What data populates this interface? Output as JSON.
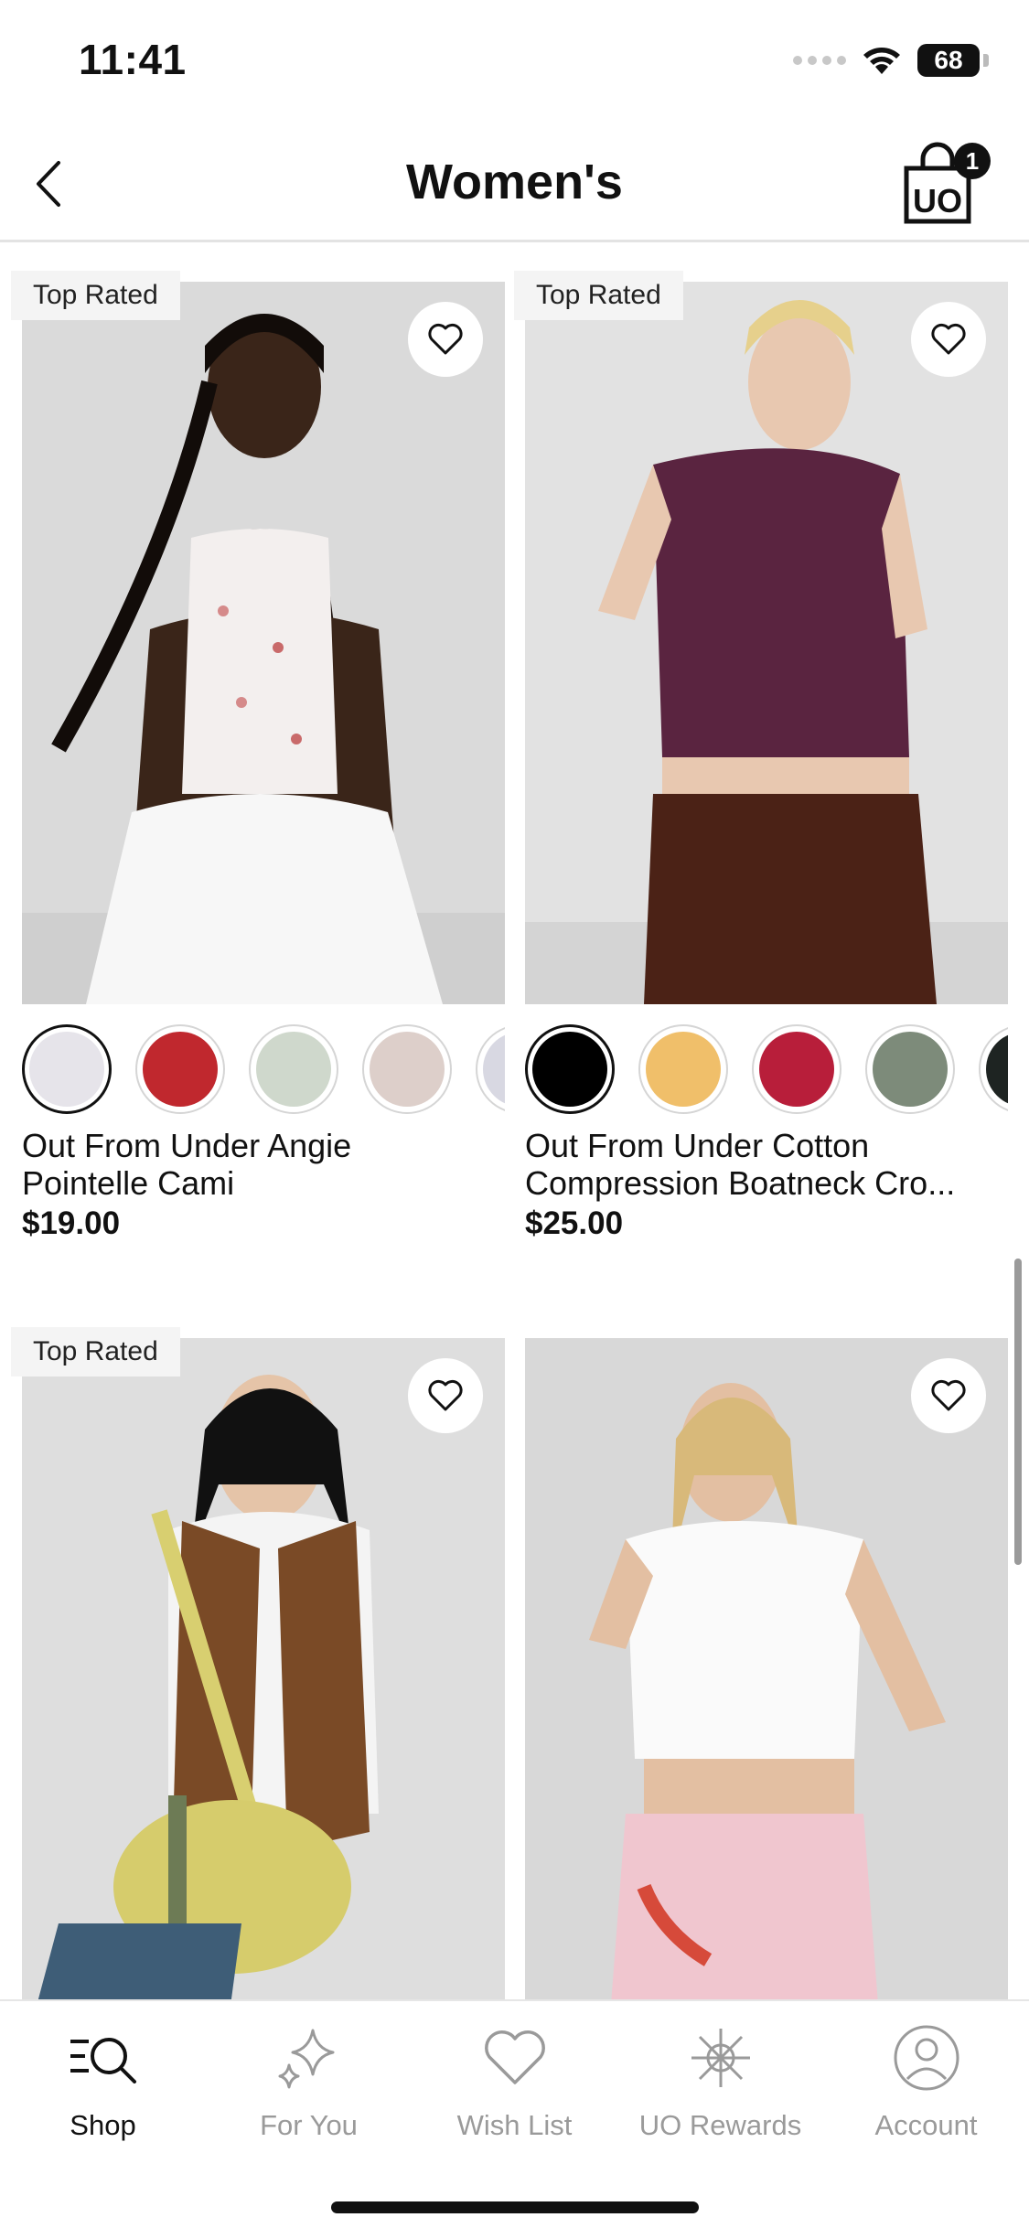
{
  "status_bar": {
    "time": "11:41",
    "battery": "68"
  },
  "header": {
    "title": "Women's",
    "bag_count": "1"
  },
  "products": [
    {
      "badge": "Top Rated",
      "name_line1": "Out From Under Angie",
      "name_line2": "Pointelle Cami",
      "price": "$19.00",
      "image_alt": "Model wearing white floral pointelle cami and white skirt",
      "swatches": [
        "#e6e4ea",
        "#c0282e",
        "#cfd8cc",
        "#ddcfca",
        "#d8d8e2"
      ],
      "selected_swatch": 0
    },
    {
      "badge": "Top Rated",
      "name_line1": "Out From Under Cotton",
      "name_line2": "Compression Boatneck Cro...",
      "price": "$25.00",
      "image_alt": "Model wearing plum boatneck crop top and brown skirt",
      "swatches": [
        "#000000",
        "#f0bf6a",
        "#b81e3a",
        "#7d8b7a",
        "#1e2422"
      ],
      "selected_swatch": 0
    },
    {
      "badge": "Top Rated",
      "image_alt": "Model wearing brown suede vest with yellow crossbody bag"
    },
    {
      "badge": "",
      "image_alt": "Model wearing white cap-sleeve top and pink striped boxer shorts"
    }
  ],
  "tabs": [
    {
      "label": "Shop",
      "icon": "shop-search-icon",
      "active": true
    },
    {
      "label": "For You",
      "icon": "sparkle-icon",
      "active": false
    },
    {
      "label": "Wish List",
      "icon": "heart-icon",
      "active": false
    },
    {
      "label": "UO Rewards",
      "icon": "rewards-star-icon",
      "active": false
    },
    {
      "label": "Account",
      "icon": "account-icon",
      "active": false
    }
  ],
  "colors": {
    "active_tab": "#111111",
    "inactive_tab": "#9a9a9a",
    "image_bg": "#dcdcdc"
  }
}
